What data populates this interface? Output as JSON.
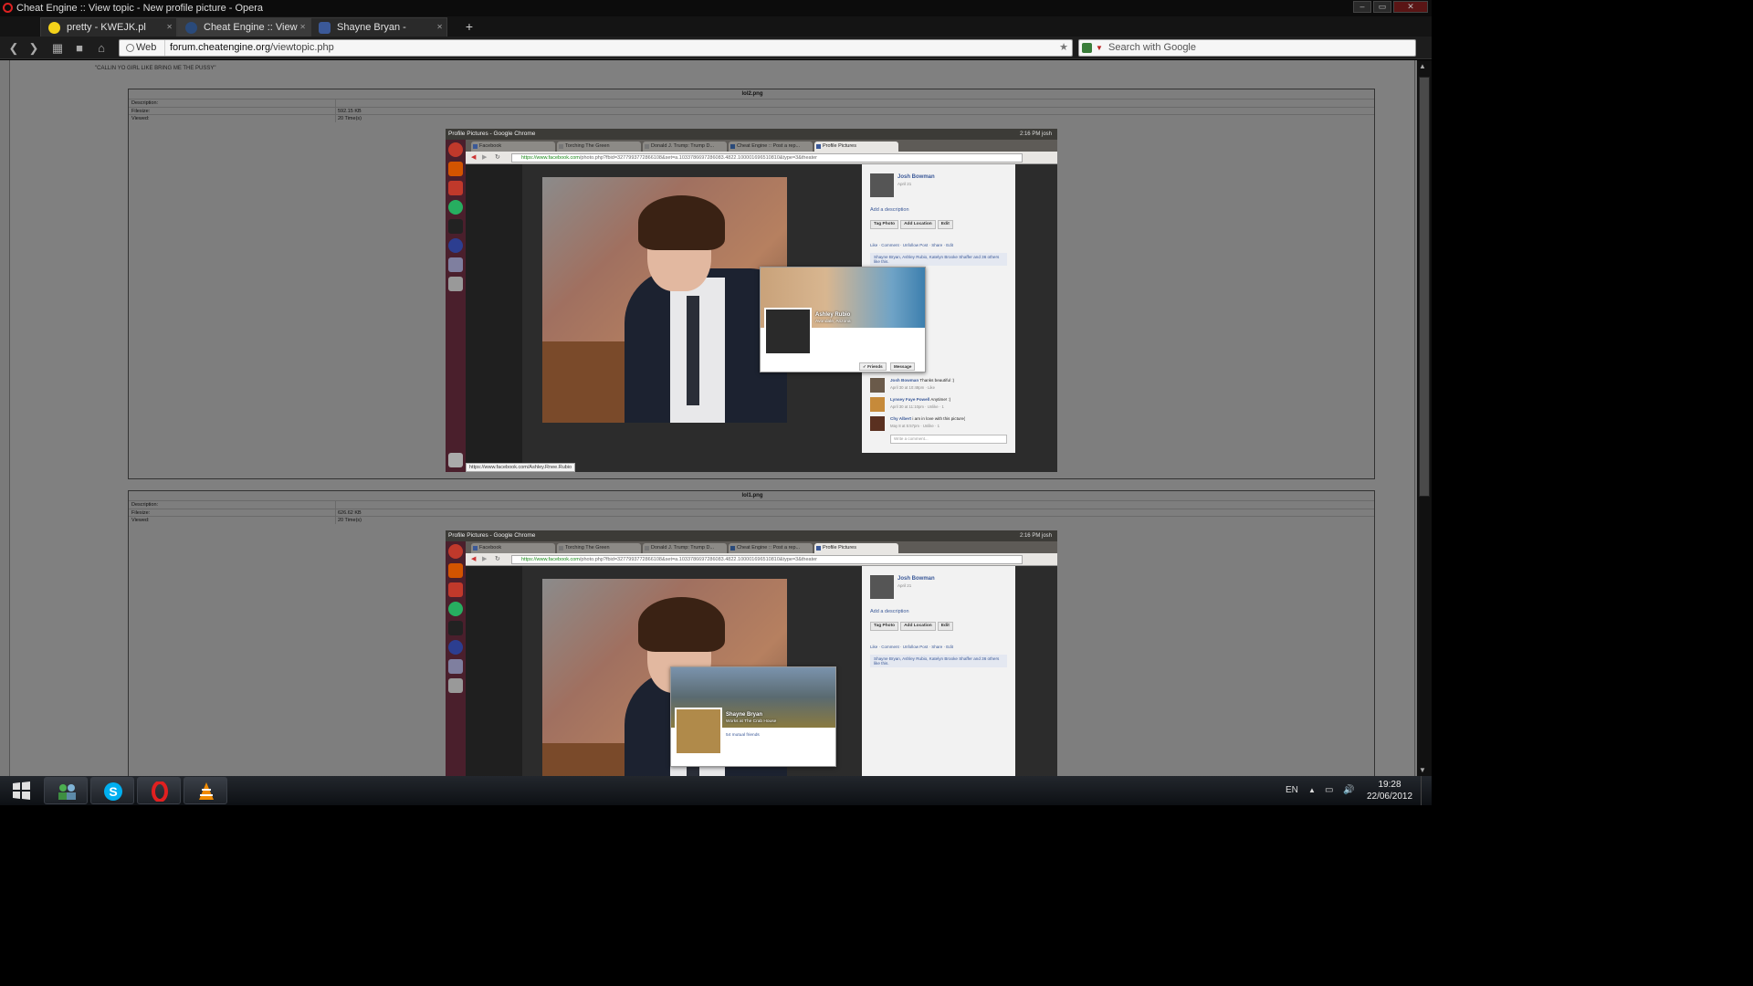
{
  "window": {
    "title": "Cheat Engine :: View topic - New profile picture - Opera",
    "controls": [
      "–",
      "▭",
      "✕"
    ]
  },
  "tabs": [
    {
      "label": "pretty - KWEJK.pl",
      "icon": "smiley-icon",
      "active": false
    },
    {
      "label": "Cheat Engine :: View t...",
      "icon": "cheat-engine-icon",
      "active": true
    },
    {
      "label": "Shayne Bryan - Messa...",
      "icon": "facebook-icon",
      "active": false
    }
  ],
  "toolbar": {
    "back": "❮",
    "forward": "❯",
    "web_label": "Web",
    "url_domain": "forum.cheatengine.org",
    "url_path": "/viewtopic.php",
    "search_placeholder": "Search with Google"
  },
  "page": {
    "quote_text": "\"CALLIN YO GIRL LIKE BRING ME THE PUSSY\"",
    "attachments": [
      {
        "filename": "lol2.png",
        "meta": [
          {
            "key": "Description:",
            "value": ""
          },
          {
            "key": "Filesize:",
            "value": "592.15 KB"
          },
          {
            "key": "Viewed:",
            "value": "20 Time(s)"
          }
        ]
      },
      {
        "filename": "lol1.png",
        "meta": [
          {
            "key": "Description:",
            "value": ""
          },
          {
            "key": "Filesize:",
            "value": "626.62 KB"
          },
          {
            "key": "Viewed:",
            "value": "20 Time(s)"
          }
        ]
      }
    ]
  },
  "screenshot": {
    "window_title": "Profile Pictures - Google Chrome",
    "top_right": "2:16 PM  josh",
    "chrome_tabs": [
      "Facebook",
      "Torching The Green",
      "Donald J. Trump: Trump D...",
      "Cheat Engine :: Post a rep...",
      "Profile Pictures"
    ],
    "url_secure": "https://www.facebook.com",
    "url_rest": "/photo.php?fbid=3277993772866108&set=a.1033786697286083.4822.100001696510810&type=3&theater",
    "owner_name": "Josh Bowman",
    "owner_date": "April 21 ",
    "add_description": "Add a description",
    "buttons": [
      "Tag Photo",
      "Add Location",
      "Edit"
    ],
    "actions": "Like · Comment · Unfollow Post · Share · Edit",
    "likes_text": "Shayne Bryan, Ashley Rubio, Katelyn Brooke Shaffer and 36 others like this.",
    "comments": [
      {
        "name": "Josh Bowman",
        "text": "Thanks beautiful :)",
        "date": "April 30 at 10:48pm · Like"
      },
      {
        "name": "Lynsey Faye Powell",
        "text": "Anytime! :)",
        "date": "April 30 at 11:10pm · Unlike · 1"
      },
      {
        "name": "Chy Albert",
        "text": "i am in love with this picture(",
        "date": "May 8 at 5:57pm · Unlike · 1"
      }
    ],
    "write_comment": "Write a comment...",
    "status_url": "https://www.facebook.com/Ashley.Rnee.Rubio",
    "popup1": {
      "name": "Ashley Rubio",
      "location": "Avondale, Arizona",
      "friends_btn": "✓ Friends",
      "message_btn": "Message"
    },
    "popup2": {
      "name": "Shayne Bryan",
      "location": "Works at The Crab House",
      "mutual": "54 mutual friends"
    }
  },
  "taskbar": {
    "language": "EN",
    "time": "19:28",
    "date": "22/06/2012"
  },
  "colors": {
    "facebook_blue": "#3b5998",
    "ubuntu_launcher": "#4a1f2c",
    "opera_red": "#d22222"
  }
}
